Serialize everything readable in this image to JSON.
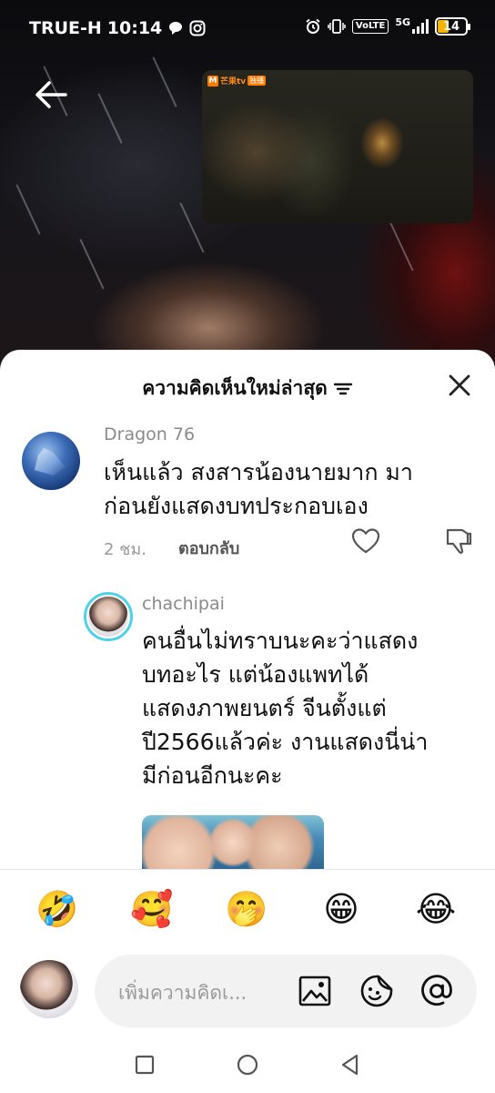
{
  "status_bar": {
    "carrier": "TRUE-H",
    "time": "10:14",
    "volte": "VoLTE",
    "network": "5G",
    "battery": "14"
  },
  "mini_player": {
    "brand": "芒果tv",
    "tag": "独播"
  },
  "sheet": {
    "title": "ความคิดเห็นใหม่ล่าสุด"
  },
  "comments": [
    {
      "username": "Dragon 76",
      "lines": [
        "เห็นแล้ว สงสารน้องนายมาก มา",
        "ก่อนยังแสดงบทประกอบเอง"
      ],
      "time": "2 ชม.",
      "reply_label": "ตอบกลับ"
    },
    {
      "username": "chachipai",
      "lines": [
        "คนอื่นไม่ทราบนะคะว่าแสดง",
        "บทอะไร แต่น้องแพทได้",
        "แสดงภาพยนตร์ จีนตั้งแต่",
        "ปี2566แล้วค่ะ งานแสดงนี่น่า",
        "มีก่อนอีกนะคะ"
      ]
    }
  ],
  "emojis": [
    "🤣",
    "🥰",
    "🤭",
    "😁",
    "😂"
  ],
  "input": {
    "placeholder": "เพิ่มความคิดเ..."
  },
  "colors": {
    "avatar_ring": "#4fd1e8",
    "battery": "#f4b400",
    "brand_orange": "#ff7a00"
  }
}
